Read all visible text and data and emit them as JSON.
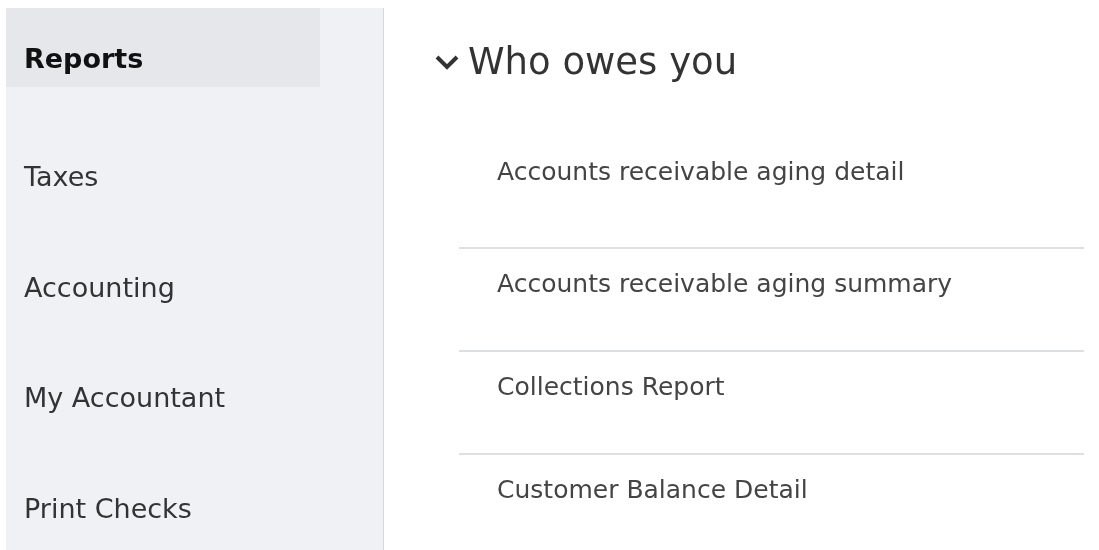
{
  "sidebar": {
    "items": [
      {
        "label": "Reports",
        "selected": true
      },
      {
        "label": "Taxes",
        "selected": false
      },
      {
        "label": "Accounting",
        "selected": false
      },
      {
        "label": "My Accountant",
        "selected": false
      },
      {
        "label": "Print Checks",
        "selected": false
      }
    ]
  },
  "section": {
    "title": "Who owes you",
    "expanded": true,
    "reports": [
      "Accounts receivable aging detail",
      "Accounts receivable aging summary",
      "Collections Report",
      "Customer Balance Detail"
    ]
  }
}
